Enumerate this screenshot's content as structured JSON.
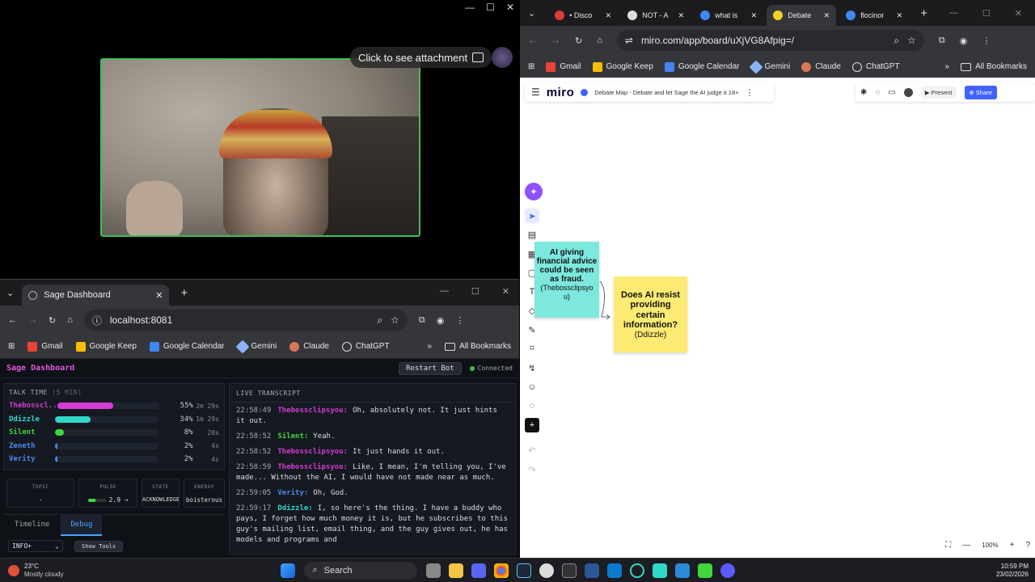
{
  "discord": {
    "attachment_label": "Click to see attachment",
    "attachment_icon": "image-icon"
  },
  "left_browser": {
    "tab_title": "Sage Dashboard",
    "url": "localhost:8081",
    "bookmarks": [
      "Gmail",
      "Google Keep",
      "Google Calendar",
      "Gemini",
      "Claude",
      "ChatGPT"
    ],
    "all_bookmarks": "All Bookmarks"
  },
  "dashboard": {
    "title": "Sage Dashboard",
    "restart_label": "Restart Bot",
    "status": "Connected",
    "status_color": "#3fbf5a",
    "talk_time_title": "TALK TIME",
    "talk_time_window": "(5 MIN)",
    "speakers": [
      {
        "name": "Thebosscl..",
        "pct_label": "55%",
        "duration": "2m 29s",
        "fraction": 0.55,
        "color": "#d63bd6"
      },
      {
        "name": "Ddizzle",
        "pct_label": "34%",
        "duration": "1m 29s",
        "fraction": 0.34,
        "color": "#2fd8c8"
      },
      {
        "name": "Silent",
        "pct_label": "8%",
        "duration": "20s",
        "fraction": 0.08,
        "color": "#3fd83f"
      },
      {
        "name": "Zeneth",
        "pct_label": "2%",
        "duration": "4s",
        "fraction": 0.02,
        "color": "#4a8ae8"
      },
      {
        "name": "Verity",
        "pct_label": "2%",
        "duration": "4s",
        "fraction": 0.02,
        "color": "#4a8ae8"
      }
    ],
    "stats": {
      "topic_label": "TOPIC",
      "topic_value": "-",
      "pulse_label": "PULSE",
      "pulse_value": "2.9 →",
      "state_label": "STATE",
      "state_value": "ACKNOWLEDGE",
      "energy_label": "ENERGY",
      "energy_value": "boisterous"
    },
    "tabs": [
      "Timeline",
      "Debug"
    ],
    "log_level": "INFO+",
    "show_tools": "Show Tools",
    "transcript_title": "LIVE TRANSCRIPT",
    "transcript": [
      {
        "time": "22:58:49",
        "speaker": "Thebossclipsyou:",
        "text": "Oh, absolutely not. It just hints it out.",
        "color": "#d63bd6"
      },
      {
        "time": "22:58:52",
        "speaker": "Silent:",
        "text": "Yeah.",
        "color": "#3fd83f"
      },
      {
        "time": "22:58:52",
        "speaker": "Thebossclipsyou:",
        "text": "It just hands it out.",
        "color": "#d63bd6"
      },
      {
        "time": "22:58:59",
        "speaker": "Thebossclipsyou:",
        "text": "Like, I mean, I'm telling you, I've made... Without the AI, I would have not made near as much.",
        "color": "#d63bd6"
      },
      {
        "time": "22:59:05",
        "speaker": "Verity:",
        "text": "Oh, God.",
        "color": "#4a8ae8"
      },
      {
        "time": "22:59:17",
        "speaker": "Ddizzle:",
        "text": "I, so here's the thing. I have a buddy who pays, I forget how much money it is, but he subscribes to this guy's mailing list, email thing, and the guy gives out, he has models and programs and",
        "color": "#2fd8c8"
      }
    ]
  },
  "right_browser": {
    "tabs": [
      {
        "label": "• Disco",
        "icon": "discord-icon",
        "color": "#e03b3b"
      },
      {
        "label": "NOT - A",
        "icon": "page-icon",
        "color": "#dddddd"
      },
      {
        "label": "what is",
        "icon": "google-icon",
        "color": "#4285f4"
      },
      {
        "label": "Debate",
        "icon": "miro-icon",
        "color": "#f5d128"
      },
      {
        "label": "flocinor",
        "icon": "google-icon",
        "color": "#4285f4"
      }
    ],
    "url": "miro.com/app/board/uXjVG8Afpig=/",
    "bookmarks": [
      "Gmail",
      "Google Keep",
      "Google Calendar",
      "Gemini",
      "Claude",
      "ChatGPT"
    ],
    "all_bookmarks": "All Bookmarks"
  },
  "miro": {
    "logo": "miro",
    "board_name": "Debate Map - Debate and let Sage the AI judge it 18+",
    "present_label": "Present",
    "share_label": "Share",
    "zoom": "100%",
    "stickies": [
      {
        "text": "AI giving financial advice could be seen as fraud.",
        "author": "(Thebossclipsyou)",
        "color": "#7de8dd"
      },
      {
        "text": "Does AI resist providing certain information?",
        "author": "(Ddizzle)",
        "color": "#fdea73"
      }
    ]
  },
  "taskbar": {
    "temp": "23°C",
    "weather": "Mostly cloudy",
    "search": "Search",
    "time": "10:59 PM",
    "date": "23/02/2026"
  }
}
